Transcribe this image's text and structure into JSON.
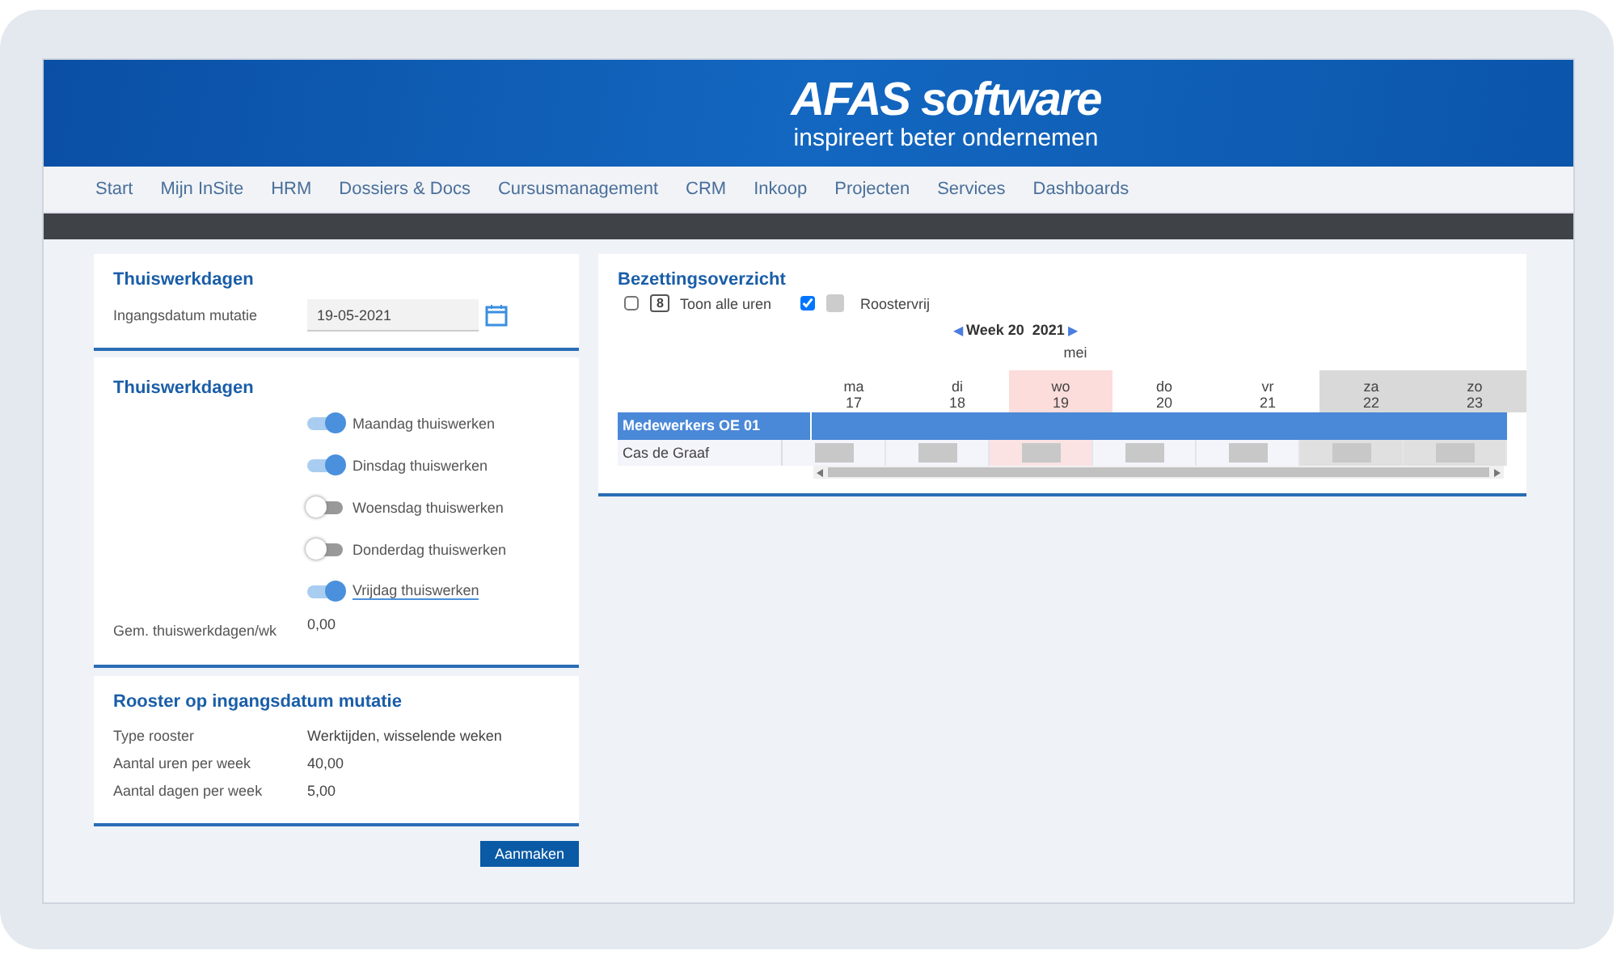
{
  "header": {
    "logo": "AFAS software",
    "tagline": "inspireert beter ondernemen"
  },
  "nav": [
    {
      "label": "Start"
    },
    {
      "label": "Mijn InSite"
    },
    {
      "label": "HRM"
    },
    {
      "label": "Dossiers & Docs"
    },
    {
      "label": "Cursusmanagement"
    },
    {
      "label": "CRM"
    },
    {
      "label": "Inkoop"
    },
    {
      "label": "Projecten"
    },
    {
      "label": "Services"
    },
    {
      "label": "Dashboards"
    }
  ],
  "mutation": {
    "title": "Thuiswerkdagen",
    "label": "Ingangsdatum mutatie",
    "value": "19-05-2021"
  },
  "workdays": {
    "title": "Thuiswerkdagen",
    "toggles": [
      {
        "label": "Maandag thuiswerken",
        "on": true,
        "focused": false
      },
      {
        "label": "Dinsdag thuiswerken",
        "on": true,
        "focused": false
      },
      {
        "label": "Woensdag thuiswerken",
        "on": false,
        "focused": false
      },
      {
        "label": "Donderdag thuiswerken",
        "on": false,
        "focused": false
      },
      {
        "label": "Vrijdag thuiswerken",
        "on": true,
        "focused": true
      }
    ],
    "average_label": "Gem. thuiswerkdagen/wk",
    "average_value": "0,00"
  },
  "schedule": {
    "title": "Rooster op ingangsdatum mutatie",
    "rows": [
      {
        "label": "Type rooster",
        "value": "Werktijden, wisselende weken"
      },
      {
        "label": "Aantal uren per week",
        "value": "40,00"
      },
      {
        "label": "Aantal dagen per week",
        "value": "5,00"
      }
    ]
  },
  "create_button": "Aanmaken",
  "occupancy": {
    "title": "Bezettingsoverzicht",
    "options": [
      {
        "checked": false,
        "badge": "8",
        "label": "Toon alle uren"
      },
      {
        "checked": true,
        "swatch": true,
        "label": "Roostervrij"
      }
    ],
    "prev": "◀",
    "week": "Week 20  2021",
    "next": "▶",
    "month": "mei",
    "days": [
      {
        "name": "ma",
        "date": "17",
        "kind": "weekday"
      },
      {
        "name": "di",
        "date": "18",
        "kind": "weekday"
      },
      {
        "name": "wo",
        "date": "19",
        "kind": "today"
      },
      {
        "name": "do",
        "date": "20",
        "kind": "weekday"
      },
      {
        "name": "vr",
        "date": "21",
        "kind": "weekday"
      },
      {
        "name": "za",
        "date": "22",
        "kind": "weekend"
      },
      {
        "name": "zo",
        "date": "23",
        "kind": "weekend"
      }
    ],
    "group": "Medewerkers OE 01",
    "employee": "Cas de Graaf"
  }
}
